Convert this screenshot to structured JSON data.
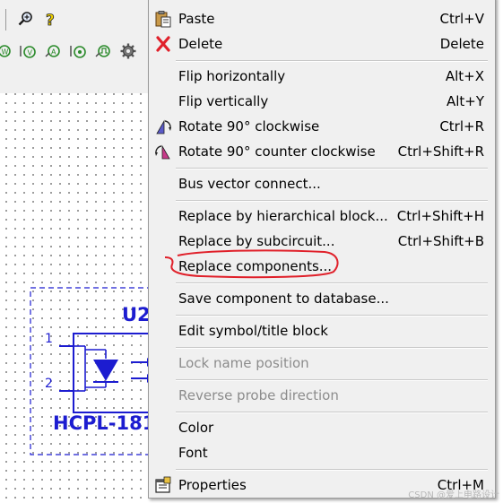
{
  "colors": {
    "schematic_blue": "#1c1cd0",
    "annotation_red": "#e0202a",
    "menu_bg": "#f0f0f0",
    "disabled_text": "#8c8c8c"
  },
  "toolbar": {
    "icons": [
      "zoom-icon",
      "help-icon",
      "voltage-source-icon",
      "current-probe-icon",
      "voltage-probe-icon",
      "pulse-icon",
      "settings-gear-icon"
    ]
  },
  "schematic": {
    "component_ref": "U2",
    "component_value": "HCPL-181",
    "pins": [
      "1",
      "2"
    ]
  },
  "menu": {
    "items": [
      {
        "label": "Paste",
        "shortcut": "Ctrl+V",
        "icon": "paste-icon",
        "enabled": true
      },
      {
        "label": "Delete",
        "shortcut": "Delete",
        "icon": "delete-x-icon",
        "enabled": true
      },
      {
        "label": "Flip horizontally",
        "shortcut": "Alt+X",
        "icon": "",
        "enabled": true
      },
      {
        "label": "Flip vertically",
        "shortcut": "Alt+Y",
        "icon": "",
        "enabled": true
      },
      {
        "label": "Rotate 90° clockwise",
        "shortcut": "Ctrl+R",
        "icon": "rotate-cw-icon",
        "enabled": true
      },
      {
        "label": "Rotate 90° counter clockwise",
        "shortcut": "Ctrl+Shift+R",
        "icon": "rotate-ccw-icon",
        "enabled": true
      },
      {
        "label": "Bus vector connect...",
        "shortcut": "",
        "icon": "",
        "enabled": true
      },
      {
        "label": "Replace by hierarchical block...",
        "shortcut": "Ctrl+Shift+H",
        "icon": "",
        "enabled": true
      },
      {
        "label": "Replace by subcircuit...",
        "shortcut": "Ctrl+Shift+B",
        "icon": "",
        "enabled": true
      },
      {
        "label": "Replace components...",
        "shortcut": "",
        "icon": "",
        "enabled": true
      },
      {
        "label": "Save component to database...",
        "shortcut": "",
        "icon": "",
        "enabled": true
      },
      {
        "label": "Edit symbol/title block",
        "shortcut": "",
        "icon": "",
        "enabled": true
      },
      {
        "label": "Lock name position",
        "shortcut": "",
        "icon": "",
        "enabled": false
      },
      {
        "label": "Reverse probe direction",
        "shortcut": "",
        "icon": "",
        "enabled": false
      },
      {
        "label": "Color",
        "shortcut": "",
        "icon": "",
        "enabled": true
      },
      {
        "label": "Font",
        "shortcut": "",
        "icon": "",
        "enabled": true
      },
      {
        "label": "Properties",
        "shortcut": "Ctrl+M",
        "icon": "properties-icon",
        "enabled": true
      }
    ]
  },
  "watermark": "CSDN @爱上电路设计"
}
